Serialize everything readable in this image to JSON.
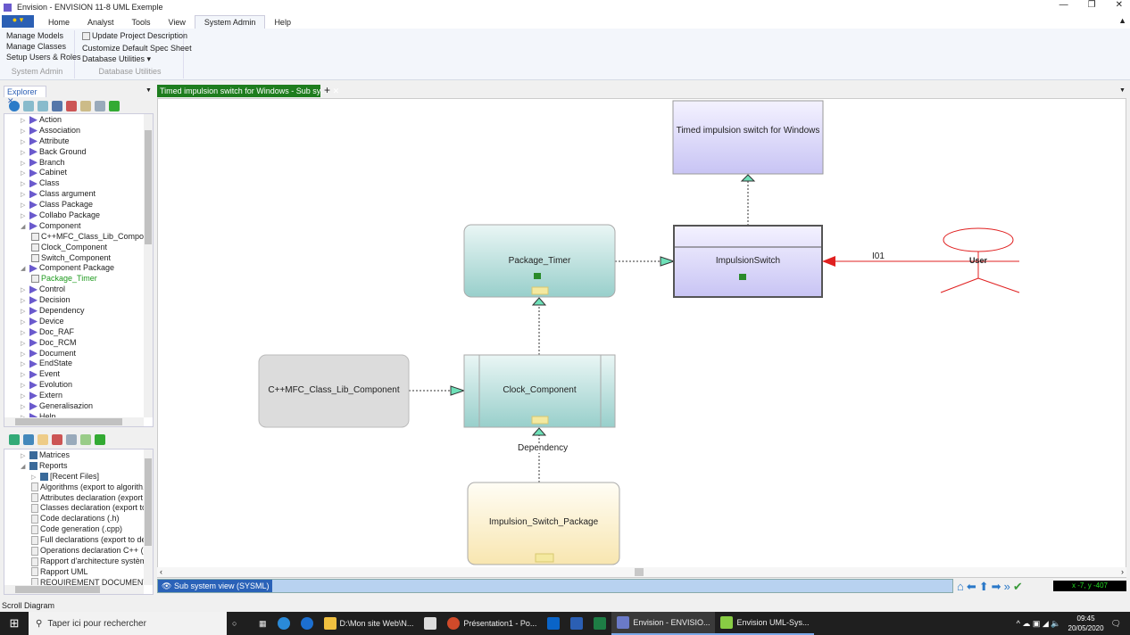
{
  "window": {
    "title": "Envision - ENVISION 11-8 UML Exemple"
  },
  "ribbon": {
    "tabs": [
      "Home",
      "Analyst",
      "Tools",
      "View",
      "System Admin",
      "Help"
    ],
    "active_tab": "System Admin",
    "groups": [
      {
        "label": "System Admin",
        "items": [
          "Manage Models",
          "Manage Classes",
          "Setup Users & Roles"
        ]
      },
      {
        "label": "Database Utilities",
        "items": [
          "Update Project Description",
          "Customize Default Spec Sheet",
          "Database Utilities ▾"
        ]
      }
    ]
  },
  "explorer": {
    "tab": "Explorer",
    "tree": [
      {
        "label": "Action",
        "level": 0,
        "type": "class"
      },
      {
        "label": "Association",
        "level": 0,
        "type": "class"
      },
      {
        "label": "Attribute",
        "level": 0,
        "type": "class"
      },
      {
        "label": "Back Ground",
        "level": 0,
        "type": "class"
      },
      {
        "label": "Branch",
        "level": 0,
        "type": "class"
      },
      {
        "label": "Cabinet",
        "level": 0,
        "type": "class"
      },
      {
        "label": "Class",
        "level": 0,
        "type": "class"
      },
      {
        "label": "Class argument",
        "level": 0,
        "type": "class"
      },
      {
        "label": "Class Package",
        "level": 0,
        "type": "class"
      },
      {
        "label": "Collabo Package",
        "level": 0,
        "type": "class"
      },
      {
        "label": "Component",
        "level": 0,
        "type": "class",
        "expanded": true
      },
      {
        "label": "C++MFC_Class_Lib_Component",
        "level": 1,
        "type": "doc"
      },
      {
        "label": "Clock_Component",
        "level": 1,
        "type": "doc"
      },
      {
        "label": "Switch_Component",
        "level": 1,
        "type": "doc"
      },
      {
        "label": "Component Package",
        "level": 0,
        "type": "class",
        "expanded": true
      },
      {
        "label": "Package_Timer",
        "level": 1,
        "type": "doc",
        "selected": true
      },
      {
        "label": "Control",
        "level": 0,
        "type": "class"
      },
      {
        "label": "Decision",
        "level": 0,
        "type": "class"
      },
      {
        "label": "Dependency",
        "level": 0,
        "type": "class"
      },
      {
        "label": "Device",
        "level": 0,
        "type": "class"
      },
      {
        "label": "Doc_RAF",
        "level": 0,
        "type": "class"
      },
      {
        "label": "Doc_RCM",
        "level": 0,
        "type": "class"
      },
      {
        "label": "Document",
        "level": 0,
        "type": "class"
      },
      {
        "label": "EndState",
        "level": 0,
        "type": "class"
      },
      {
        "label": "Event",
        "level": 0,
        "type": "class"
      },
      {
        "label": "Evolution",
        "level": 0,
        "type": "class"
      },
      {
        "label": "Extern",
        "level": 0,
        "type": "class"
      },
      {
        "label": "Generalisazion",
        "level": 0,
        "type": "class"
      },
      {
        "label": "Help",
        "level": 0,
        "type": "class"
      }
    ]
  },
  "reports": {
    "tree": [
      {
        "label": "Matrices",
        "level": 0,
        "type": "folder"
      },
      {
        "label": "Reports",
        "level": 0,
        "type": "folder",
        "expanded": true
      },
      {
        "label": "[Recent Files]",
        "level": 1,
        "type": "folder"
      },
      {
        "label": "Algorithms (export to algorith.cpp",
        "level": 1,
        "type": "rep"
      },
      {
        "label": "Attributes declaration (export to",
        "level": 1,
        "type": "rep"
      },
      {
        "label": "Classes declaration (export to cla",
        "level": 1,
        "type": "rep"
      },
      {
        "label": "Code declarations (.h)",
        "level": 1,
        "type": "rep"
      },
      {
        "label": "Code generation (.cpp)",
        "level": 1,
        "type": "rep"
      },
      {
        "label": "Full declarations (export to decla",
        "level": 1,
        "type": "rep"
      },
      {
        "label": "Operations declaration C++ (exp",
        "level": 1,
        "type": "rep"
      },
      {
        "label": "Rapport d'architecture système",
        "level": 1,
        "type": "rep"
      },
      {
        "label": "Rapport UML",
        "level": 1,
        "type": "rep"
      },
      {
        "label": "REQUIREMENT DOCUMENT",
        "level": 1,
        "type": "rep"
      }
    ]
  },
  "document_tab": {
    "label": "Timed impulsion switch for Windows - Sub sy...",
    "color": "#1e7d1e"
  },
  "diagram": {
    "nodes": {
      "timed": "Timed impulsion switch for Windows",
      "package_timer": "Package_Timer",
      "impulsion_switch": "ImpulsionSwitch",
      "user": "User",
      "cpp": "C++MFC_Class_Lib_Component",
      "clock": "Clock_Component",
      "pkg": "Impulsion_Switch_Package"
    },
    "labels": {
      "i01": "I01",
      "dependency": "Dependency"
    }
  },
  "view_bar": {
    "label": "Sub system view (SYSML)",
    "coords": "x -7, y -407"
  },
  "status": "Scroll Diagram",
  "taskbar": {
    "search": "Taper ici pour rechercher",
    "apps": [
      "D:\\Mon site Web\\N...",
      "Présentation1 - Po...",
      "Envision - ENVISIO...",
      "Envision UML-Sys..."
    ],
    "time": "09:45",
    "date": "20/05/2020"
  }
}
